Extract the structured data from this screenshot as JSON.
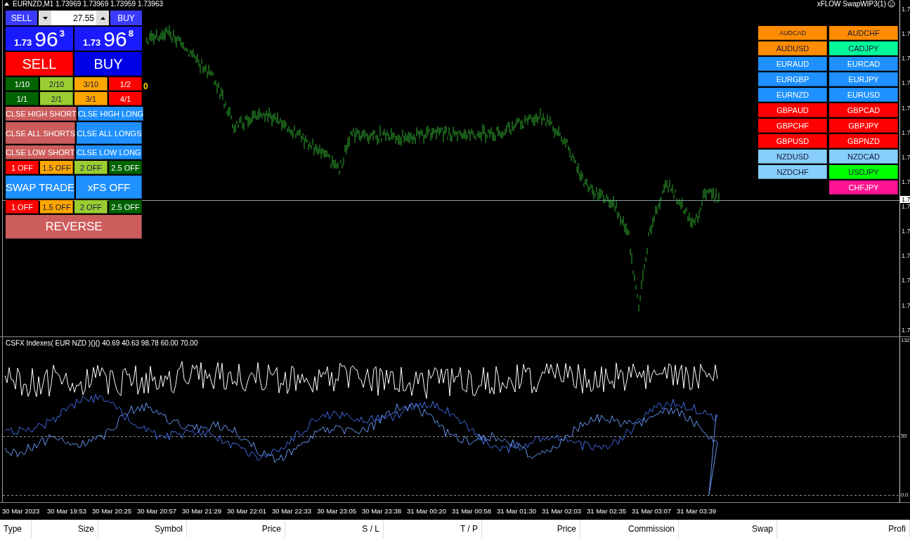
{
  "chart": {
    "title": "EURNZD,M1  1.73969 1.73969 1.73959 1.73963",
    "expert": "xFLOW SwapWIP3(1)",
    "price_axis": [
      "1.7",
      "1.7",
      "1.7",
      "1.7",
      "1.7",
      "1.7",
      "1.7",
      "1.7",
      "1.7",
      "1.7",
      "1.7",
      "1.7",
      "1.7",
      "1.7"
    ],
    "current_price": "1.7"
  },
  "panel": {
    "order_bar": {
      "sell": "SELL",
      "lot": "27.55",
      "buy": "BUY"
    },
    "quotes": [
      {
        "prefix": "1.73",
        "pips": "96",
        "fraction": "3"
      },
      {
        "prefix": "1.73",
        "pips": "96",
        "fraction": "8"
      }
    ],
    "trade_buttons": [
      {
        "label": "SELL",
        "color": "#ff0000"
      },
      {
        "label": "BUY",
        "color": "#0000e6"
      }
    ],
    "lot_counter": "0",
    "button_rows": [
      {
        "kind": "small",
        "items": [
          {
            "label": "1/10",
            "color": "#006400"
          },
          {
            "label": "2/10",
            "color": "#9acd32"
          },
          {
            "label": "3/10",
            "color": "#ffa500"
          },
          {
            "label": "1/2",
            "color": "#ff0000"
          }
        ]
      },
      {
        "kind": "small",
        "items": [
          {
            "label": "1/1",
            "color": "#006400"
          },
          {
            "label": "2/1",
            "color": "#9acd32"
          },
          {
            "label": "3/1",
            "color": "#ffa500"
          },
          {
            "label": "4/1",
            "color": "#ff0000"
          }
        ]
      },
      {
        "kind": "medium",
        "items": [
          {
            "label": "CLSE HIGH SHORT",
            "color": "#cd5c5c"
          },
          {
            "label": "CLSE HIGH LONG",
            "color": "#1e90ff"
          }
        ]
      },
      {
        "kind": "tall",
        "items": [
          {
            "label": "CLSE ALL SHORTS",
            "color": "#cd5c5c"
          },
          {
            "label": "CLSE ALL LONGS",
            "color": "#1e90ff"
          }
        ]
      },
      {
        "kind": "medium",
        "items": [
          {
            "label": "CLSE LOW SHORT",
            "color": "#cd5c5c"
          },
          {
            "label": "CLSE LOW LONG",
            "color": "#1e90ff"
          }
        ]
      },
      {
        "kind": "small",
        "items": [
          {
            "label": "1 OFF",
            "color": "#ff0000"
          },
          {
            "label": "1.5 OFF",
            "color": "#ffa500"
          },
          {
            "label": "2 OFF",
            "color": "#9acd32"
          },
          {
            "label": "2.5 OFF",
            "color": "#006400"
          }
        ]
      },
      {
        "kind": "large",
        "items": [
          {
            "label": "SWAP TRADE",
            "color": "#1e90ff"
          },
          {
            "label": "xFS OFF",
            "color": "#1e90ff"
          }
        ]
      },
      {
        "kind": "small",
        "items": [
          {
            "label": "1 OFF",
            "color": "#ff0000"
          },
          {
            "label": "1.5 OFF",
            "color": "#ffa500"
          },
          {
            "label": "2 OFF",
            "color": "#9acd32"
          },
          {
            "label": "2.5 OFF",
            "color": "#006400"
          }
        ]
      },
      {
        "kind": "huge",
        "items": [
          {
            "label": "REVERSE",
            "color": "#cd5c5c"
          }
        ]
      }
    ]
  },
  "pairs": [
    {
      "label": "AUDCAD",
      "color": "#ff8c00",
      "small": true
    },
    {
      "label": "AUDCHF",
      "color": "#ff8c00",
      "small": false
    },
    {
      "label": "AUDUSD",
      "color": "#ff8c00",
      "small": false
    },
    {
      "label": "CADJPY",
      "color": "#00fa9a",
      "small": false
    },
    {
      "label": "EURAUD",
      "color": "#1e90ff",
      "small": false
    },
    {
      "label": "EURCAD",
      "color": "#1e90ff",
      "small": false
    },
    {
      "label": "EURGBP",
      "color": "#1e90ff",
      "small": false
    },
    {
      "label": "EURJPY",
      "color": "#1e90ff",
      "small": false
    },
    {
      "label": "EURNZD",
      "color": "#1e90ff",
      "small": false
    },
    {
      "label": "EURUSD",
      "color": "#1e90ff",
      "small": false
    },
    {
      "label": "GBPAUD",
      "color": "#ff0000",
      "small": false
    },
    {
      "label": "GBPCAD",
      "color": "#ff0000",
      "small": false
    },
    {
      "label": "GBPCHF",
      "color": "#ff0000",
      "small": false
    },
    {
      "label": "GBPJPY",
      "color": "#ff0000",
      "small": false
    },
    {
      "label": "GBPUSD",
      "color": "#ff0000",
      "small": false
    },
    {
      "label": "GBPNZD",
      "color": "#ff0000",
      "small": false
    },
    {
      "label": "NZDUSD",
      "color": "#87cefa",
      "small": false
    },
    {
      "label": "NZDCAD",
      "color": "#87cefa",
      "small": false
    },
    {
      "label": "NZDCHF",
      "color": "#87cefa",
      "small": false
    },
    {
      "label": "USDJPY",
      "color": "#00ff00",
      "small": false
    },
    {
      "label": "CHFJPY",
      "color": "#ff1493",
      "small": false
    }
  ],
  "indicator": {
    "title": "CSFX Indexes( EUR NZD )()() 40.69 40.63 98.78 60.00 70.00",
    "axis": [
      "132",
      "50",
      "0.0"
    ]
  },
  "time_axis": [
    "30 Mar 2023",
    "30 Mar 19:53",
    "30 Mar 20:25",
    "30 Mar 20:57",
    "30 Mar 21:29",
    "30 Mar 22:01",
    "30 Mar 22:33",
    "30 Mar 23:05",
    "30 Mar 23:38",
    "31 Mar 00:20",
    "31 Mar 00:58",
    "31 Mar 01:30",
    "31 Mar 02:03",
    "31 Mar 02:35",
    "31 Mar 03:07",
    "31 Mar 03:39"
  ],
  "table": {
    "columns": [
      "Type",
      "Size",
      "Symbol",
      "Price",
      "S / L",
      "T / P",
      "Price",
      "Commission",
      "Swap",
      "Profi"
    ]
  }
}
